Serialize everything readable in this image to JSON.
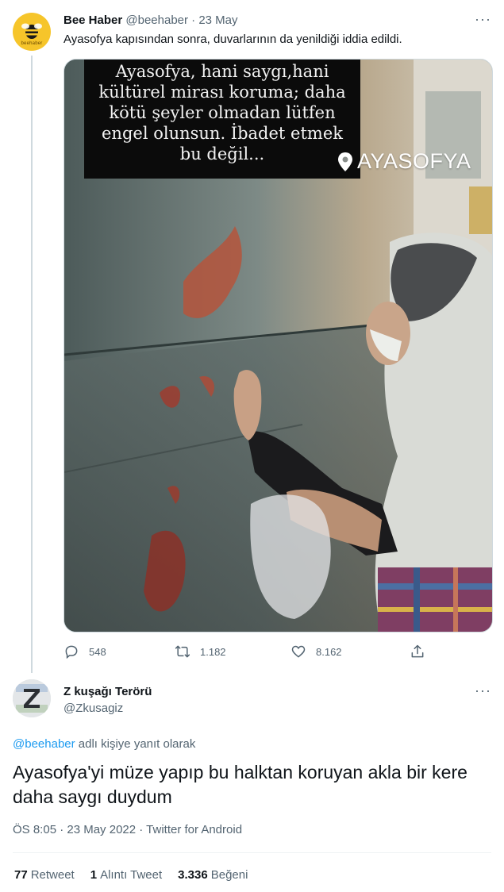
{
  "parent_tweet": {
    "author_name": "Bee Haber",
    "handle_and_date": "@beehaber · 23 May",
    "avatar_text": "beehaber",
    "text": "Ayasofya kapısından sonra, duvarlarının da yenildiği iddia edildi.",
    "media": {
      "caption_lines": [
        "Ayasofya, hani saygı,hani",
        "kültürel mirası koruma; daha",
        "kötü şeyler olmadan lütfen",
        "engel olunsun. İbadet etmek",
        "bu değil..."
      ],
      "location_tag": "AYASOFYA"
    },
    "actions": {
      "replies": "548",
      "retweets": "1.182",
      "likes": "8.162"
    },
    "icons": [
      "reply-icon",
      "retweet-icon",
      "like-icon",
      "share-icon",
      "more-icon",
      "location-pin-icon"
    ]
  },
  "reply_tweet": {
    "author_name": "Z kuşağı Terörü",
    "handle": "@Zkusagiz",
    "replying_mention": "@beehaber",
    "replying_suffix": " adlı kişiye yanıt olarak",
    "text": "Ayasofya'yi müze yapıp bu halktan koruyan akla bir kere daha saygı duydum",
    "timestamp": "ÖS 8:05 · 23 May 2022 · Twitter for Android",
    "stats": {
      "retweet_count": "77",
      "retweet_label": "Retweet",
      "quote_count": "1",
      "quote_label": "Alıntı Tweet",
      "like_count": "3.336",
      "like_label": "Beğeni"
    }
  },
  "colors": {
    "text_primary": "#0f1419",
    "text_secondary": "#536471",
    "link": "#1d9bf0",
    "divider": "#eff3f4",
    "bee_brand": "#f6c52a"
  }
}
